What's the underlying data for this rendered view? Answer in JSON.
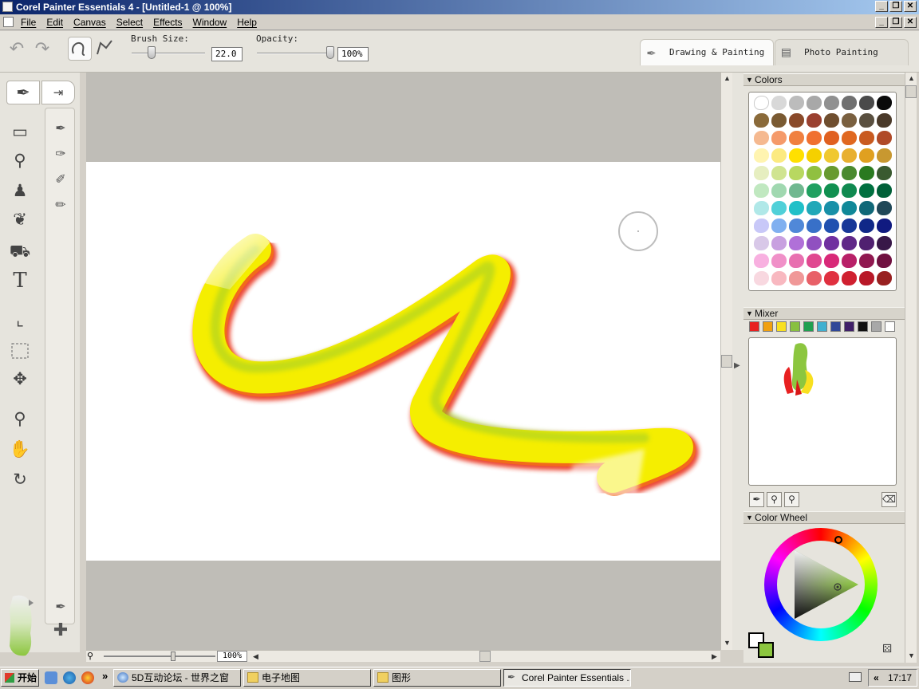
{
  "window": {
    "title": "Corel Painter Essentials 4 - [Untitled-1 @ 100%]",
    "controls": [
      "_",
      "❐",
      "✕"
    ]
  },
  "menu": {
    "items": [
      "File",
      "Edit",
      "Canvas",
      "Select",
      "Effects",
      "Window",
      "Help"
    ]
  },
  "propbar": {
    "brush_size_label": "Brush Size:",
    "brush_size_value": "22.0",
    "brush_size_level": 0.27,
    "opacity_label": "Opacity:",
    "opacity_value": "100%",
    "opacity_level": 1.0,
    "tab_drawing": "Drawing & Painting",
    "tab_photo": "Photo Painting"
  },
  "toolbox": {
    "text_tool_glyph": "T",
    "tools": [
      "brush-tool",
      "eraser-tool",
      "dropper-tool",
      "clone-stamp-tool",
      "eyedropper-tool",
      "paint-bucket-tool",
      "text-tool",
      "crop-tool",
      "rect-select-tool",
      "move-tool",
      "zoom-tool",
      "grab-tool",
      "rotate-tool"
    ]
  },
  "canvas": {
    "zoom": "100%",
    "stroke_colors": [
      "#f5ee00",
      "#9ccc2c",
      "#f26a1b",
      "#e9301f"
    ]
  },
  "panels": {
    "colors_title": "Colors",
    "mixer_title": "Mixer",
    "color_wheel_title": "Color Wheel",
    "palette": [
      [
        "#ffffff",
        "#d8d8d8",
        "#bcbcbc",
        "#a8a8a8",
        "#909090",
        "#707070",
        "#4a4a4a",
        "#0a0a0a"
      ],
      [
        "#8a6a3a",
        "#7a5a32",
        "#8a4a2a",
        "#9a4030",
        "#6f4e2f",
        "#7a6040",
        "#5a5040",
        "#4a3a2a"
      ],
      [
        "#f5b990",
        "#f59a6a",
        "#f08040",
        "#f07030",
        "#e06020",
        "#e06820",
        "#c85a20",
        "#b04a28"
      ],
      [
        "#fff4b0",
        "#fcea80",
        "#ffe000",
        "#f5d000",
        "#f0c830",
        "#e8b030",
        "#e0a020",
        "#c89830"
      ],
      [
        "#e6eec0",
        "#d0e490",
        "#b8d860",
        "#90c040",
        "#689a30",
        "#4a8a30",
        "#2a7a20",
        "#3a5a30"
      ],
      [
        "#c0e8c0",
        "#a0d8b0",
        "#70b890",
        "#20a060",
        "#109050",
        "#108a50",
        "#007040",
        "#006038"
      ],
      [
        "#b0e8e8",
        "#50d0d8",
        "#20c0c8",
        "#20a8b8",
        "#1890a8",
        "#108898",
        "#106878",
        "#204858"
      ],
      [
        "#c8c8f8",
        "#80b0f0",
        "#5088d8",
        "#3870c8",
        "#2050b0",
        "#183898",
        "#102888",
        "#101a80"
      ],
      [
        "#d8c8e8",
        "#c8a0e0",
        "#b070d8",
        "#9050c0",
        "#7030a0",
        "#602888",
        "#502070",
        "#381848"
      ],
      [
        "#f8b0e0",
        "#f090c8",
        "#e870b0",
        "#e04890",
        "#d82878",
        "#b82068",
        "#901850",
        "#701040"
      ],
      [
        "#f8d8e0",
        "#f8b8c0",
        "#f09898",
        "#e86068",
        "#e03040",
        "#d02030",
        "#b81828",
        "#982020"
      ]
    ],
    "mixer_swatches": [
      "#e82020",
      "#f0a010",
      "#f8e020",
      "#88c040",
      "#20a050",
      "#40b0d0",
      "#304898",
      "#402068",
      "#101010",
      "#a8a8a8",
      "#ffffff"
    ],
    "primary_color": "#ffffff",
    "secondary_color": "#8cc63f"
  },
  "taskbar": {
    "start_label": "开始",
    "overflow": "»",
    "tasks": [
      "5D互动论坛 - 世界之窗",
      "电子地图",
      "图形",
      "Corel Painter Essentials ..."
    ],
    "tray_chevron": "«",
    "time": "17:17"
  }
}
